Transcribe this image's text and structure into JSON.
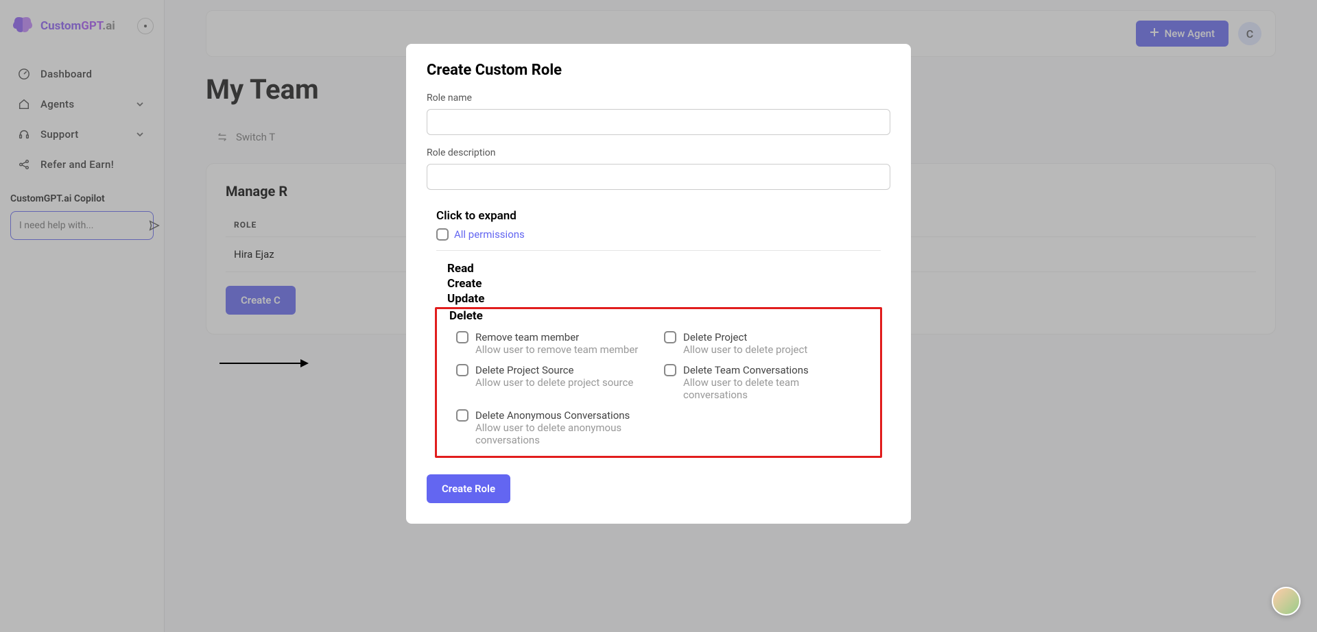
{
  "brand": {
    "text1": "Custom",
    "text2": "GPT",
    "text3": ".ai"
  },
  "sidebar": {
    "items": [
      {
        "label": "Dashboard"
      },
      {
        "label": "Agents"
      },
      {
        "label": "Support"
      },
      {
        "label": "Refer and Earn!"
      }
    ],
    "copilot_label": "CustomGPT.ai Copilot",
    "copilot_placeholder": "I need help with..."
  },
  "topbar": {
    "new_agent": "New Agent",
    "avatar": "C"
  },
  "page": {
    "title": "My Team"
  },
  "switch": "Switch T",
  "card": {
    "title": "Manage R",
    "role_header": "ROLE",
    "role_row": "Hira Ejaz",
    "create_btn": "Create C"
  },
  "modal": {
    "title": "Create Custom Role",
    "role_name_label": "Role name",
    "role_desc_label": "Role description",
    "expand_label": "Click to expand",
    "all_permissions": "All permissions",
    "sections": {
      "read": "Read",
      "create": "Create",
      "update": "Update",
      "delete": "Delete"
    },
    "perms": [
      {
        "title": "Remove team member",
        "desc": "Allow user to remove team member"
      },
      {
        "title": "Delete Project",
        "desc": "Allow user to delete project"
      },
      {
        "title": "Delete Project Source",
        "desc": "Allow user to delete project source"
      },
      {
        "title": "Delete Team Conversations",
        "desc": "Allow user to delete team conversations"
      },
      {
        "title": "Delete Anonymous Conversations",
        "desc": "Allow user to delete anonymous conversations"
      }
    ],
    "create_role_btn": "Create Role"
  }
}
